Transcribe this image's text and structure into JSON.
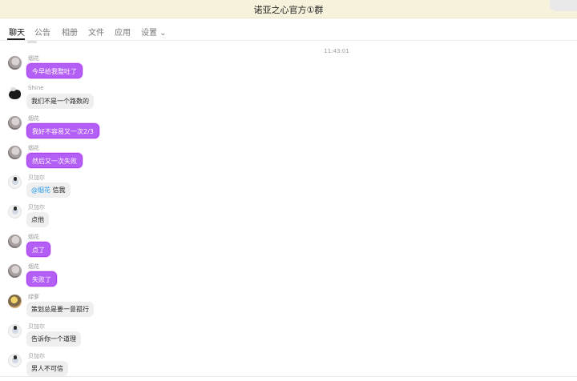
{
  "window": {
    "title": "诺亚之心官方①群"
  },
  "tabs": [
    {
      "label": "聊天",
      "active": true
    },
    {
      "label": "公告"
    },
    {
      "label": "相册"
    },
    {
      "label": "文件"
    },
    {
      "label": "应用"
    },
    {
      "label": "设置 ⌄"
    }
  ],
  "chat": {
    "timestamp": "11:43:01",
    "messages": [
      {
        "sender": "烟花",
        "avatar": "smoke-avatar",
        "text": "今早给我整吐了",
        "bubble": "purple"
      },
      {
        "sender": "Shine",
        "avatar": "shine-avatar",
        "text": "我们不是一个路数的",
        "bubble": "gray"
      },
      {
        "sender": "烟花",
        "avatar": "smoke-avatar",
        "text": "我好不容易又一次2/3",
        "bubble": "purple"
      },
      {
        "sender": "烟花",
        "avatar": "smoke-avatar",
        "text": "然后又一次失败",
        "bubble": "purple"
      },
      {
        "sender": "贝加尔",
        "avatar": "bell-avatar",
        "mention": "@烟花",
        "text": " 信我",
        "bubble": "gray"
      },
      {
        "sender": "贝加尔",
        "avatar": "bell-avatar",
        "text": "点他",
        "bubble": "gray"
      },
      {
        "sender": "烟花",
        "avatar": "smoke-avatar",
        "text": "点了",
        "bubble": "purple"
      },
      {
        "sender": "烟花",
        "avatar": "smoke-avatar",
        "text": "失败了",
        "bubble": "purple"
      },
      {
        "sender": "绿萝",
        "avatar": "lu-avatar",
        "text": "策划总是要一意孤行",
        "bubble": "gray"
      },
      {
        "sender": "贝加尔",
        "avatar": "bell-avatar",
        "text": "告诉你一个道理",
        "bubble": "gray"
      },
      {
        "sender": "贝加尔",
        "avatar": "bell-avatar",
        "text": "男人不可信",
        "bubble": "gray"
      }
    ]
  }
}
